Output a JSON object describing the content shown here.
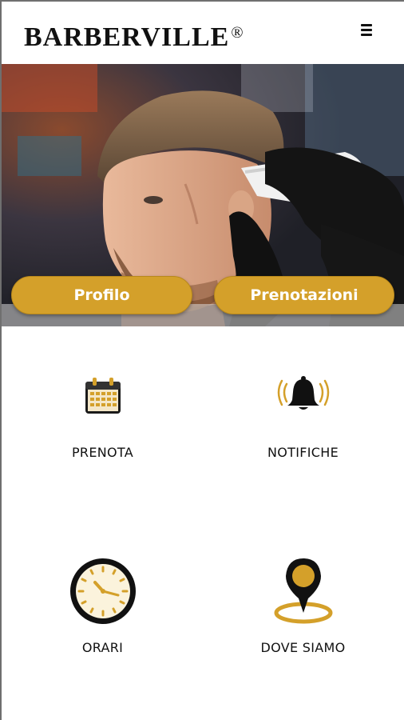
{
  "header": {
    "brand": "BARBERVILLE",
    "registered_mark": "®",
    "menu_icon": "hamburger-menu-icon"
  },
  "hero": {
    "image": "barber-haircut-photo",
    "buttons": {
      "profile_label": "Profilo",
      "bookings_label": "Prenotazioni"
    }
  },
  "tiles": [
    {
      "label": "PRENOTA",
      "icon": "calendar-icon"
    },
    {
      "label": "NOTIFICHE",
      "icon": "bell-ringing-icon"
    },
    {
      "label": "ORARI",
      "icon": "clock-icon"
    },
    {
      "label": "DOVE SIAMO",
      "icon": "location-pin-icon"
    }
  ],
  "colors": {
    "accent": "#d4a02a",
    "text": "#111111",
    "background": "#ffffff"
  }
}
